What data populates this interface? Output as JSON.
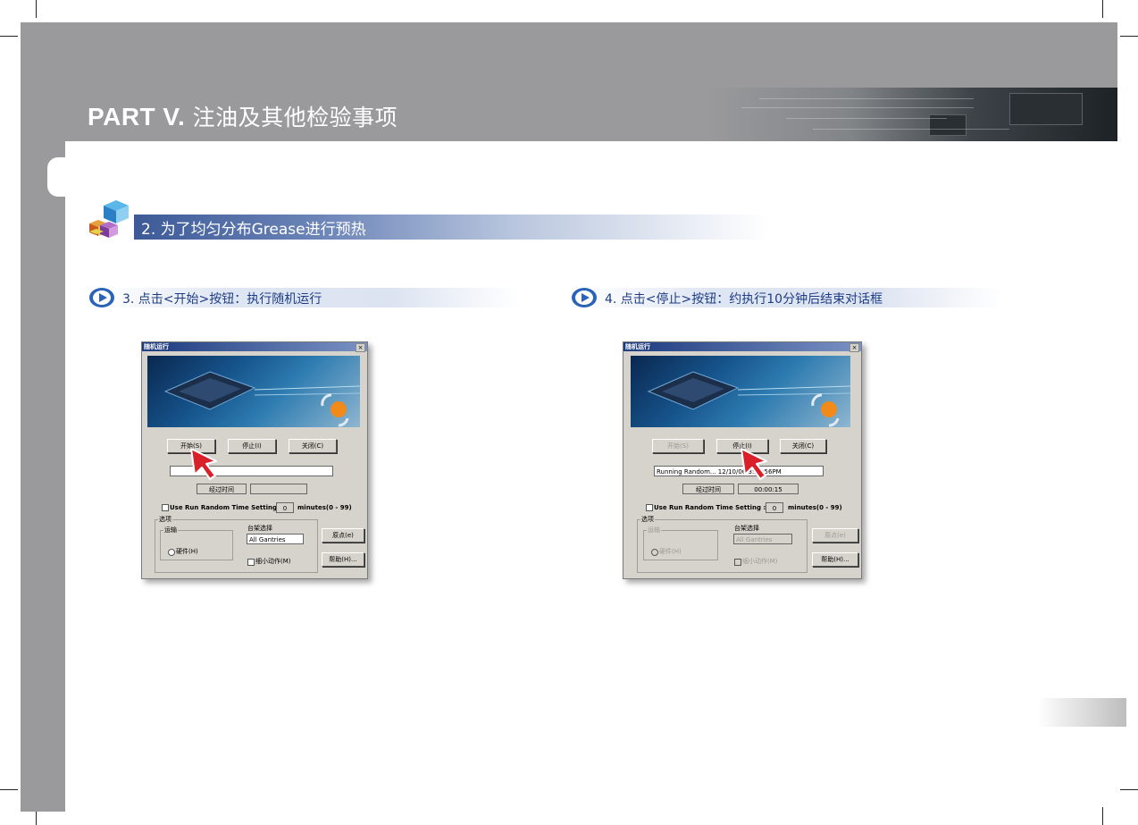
{
  "header": {
    "part_label": "PART V.",
    "part_title": "注油及其他检验事项"
  },
  "section": {
    "title": "2. 为了均匀分布Grease进行预热"
  },
  "steps": [
    {
      "title": "3. 点击<开始>按钮：执行随机运行",
      "dialog": {
        "title": "随机运行",
        "close": "×",
        "start_btn": "开始(S)",
        "stop_btn": "停止(I)",
        "close_btn": "关闭(C)",
        "status": "",
        "elapsed_label": "经过时间",
        "elapsed_value": "",
        "use_time_label": "Use Run Random Time Setting :",
        "minutes_value": "0",
        "minutes_label": "minutes(0 - 99)",
        "options_label": "选项",
        "transport_label": "运输",
        "hardware_label": "硬件(H)",
        "gantry_label": "台架选择",
        "gantry_value": "All Gantries",
        "small_motion_label": "细小动作(M)",
        "origin_btn": "原点(e)",
        "help_btn": "帮助(H)..."
      }
    },
    {
      "title": "4. 点击<停止>按钮：约执行10分钟后结束对话框",
      "dialog": {
        "title": "随机运行",
        "close": "×",
        "start_btn": "开始(S)",
        "stop_btn": "停止(I)",
        "close_btn": "关闭(C)",
        "status": "Running Random... 12/10/06 3:38:56PM",
        "elapsed_label": "经过时间",
        "elapsed_value": "00:00:15",
        "use_time_label": "Use Run Random Time Setting :",
        "minutes_value": "0",
        "minutes_label": "minutes(0 - 99)",
        "options_label": "选项",
        "transport_label": "运输",
        "hardware_label": "硬件(H)",
        "gantry_label": "台架选择",
        "gantry_value": "All Gantries",
        "small_motion_label": "细小动作(M)",
        "origin_btn": "原点(e)",
        "help_btn": "帮助(H)..."
      }
    }
  ],
  "colors": {
    "header_grey": "#9a9a9c",
    "banner_blue": "#3d5a98",
    "step_text": "#1e3d86",
    "cursor_red": "#d9202a"
  }
}
